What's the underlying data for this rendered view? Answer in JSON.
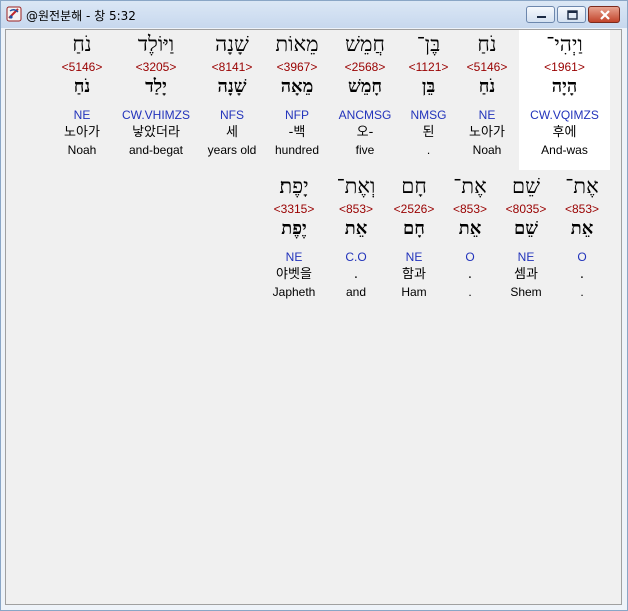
{
  "window": {
    "title": "@원전분해 - 창 5:32",
    "icon": "app-icon",
    "controls": [
      "minimize-icon",
      "maximize-icon",
      "close-icon"
    ]
  },
  "words": [
    {
      "heb": "וַיְהִי־",
      "strong": "<1961>",
      "lemma": "הָיָה",
      "morph": "CW.VQIMZS",
      "kor": "후에",
      "eng": "And-was",
      "highlight": true
    },
    {
      "heb": "נֹחַ",
      "strong": "<5146>",
      "lemma": "נֹחַ",
      "morph": "NE",
      "kor": "노아가",
      "eng": "Noah"
    },
    {
      "heb": "בֶּן־",
      "strong": "<1121>",
      "lemma": "בֵּן",
      "morph": "NMSG",
      "kor": "된",
      "eng": "."
    },
    {
      "heb": "חֲמֵשׁ",
      "strong": "<2568>",
      "lemma": "חָמֵשׁ",
      "morph": "ANCMSG",
      "kor": "오-",
      "eng": "five"
    },
    {
      "heb": "מֵאוֹת",
      "strong": "<3967>",
      "lemma": "מֵאָה",
      "morph": "NFP",
      "kor": "-백",
      "eng": "hundred"
    },
    {
      "heb": "שָׁנָה",
      "strong": "<8141>",
      "lemma": "שָׁנָה",
      "morph": "NFS",
      "kor": "세",
      "eng": "years old"
    },
    {
      "heb": "וַיּוֹלֶד",
      "strong": "<3205>",
      "lemma": "יָלַד",
      "morph": "CW.VHIMZS",
      "kor": "낳았더라",
      "eng": "and-begat"
    },
    {
      "heb": "נֹחַ",
      "strong": "<5146>",
      "lemma": "נֹחַ",
      "morph": "NE",
      "kor": "노아가",
      "eng": "Noah"
    },
    {
      "heb": "אֶת־",
      "strong": "<853>",
      "lemma": "אֵת",
      "morph": "O",
      "kor": ".",
      "eng": "."
    },
    {
      "heb": "שֵׁם",
      "strong": "<8035>",
      "lemma": "שֵׁם",
      "morph": "NE",
      "kor": "셈과",
      "eng": "Shem"
    },
    {
      "heb": "אֶת־",
      "strong": "<853>",
      "lemma": "אֵת",
      "morph": "O",
      "kor": ".",
      "eng": "."
    },
    {
      "heb": "חָם",
      "strong": "<2526>",
      "lemma": "חָם",
      "morph": "NE",
      "kor": "함과",
      "eng": "Ham"
    },
    {
      "heb": "וְאֶת־",
      "strong": "<853>",
      "lemma": "אֵת",
      "morph": "C.O",
      "kor": ".",
      "eng": "and"
    },
    {
      "heb": "יָפֶת׃",
      "strong": "<3315>",
      "lemma": "יֶפֶת",
      "morph": "NE",
      "kor": "야벳을",
      "eng": "Japheth"
    }
  ]
}
